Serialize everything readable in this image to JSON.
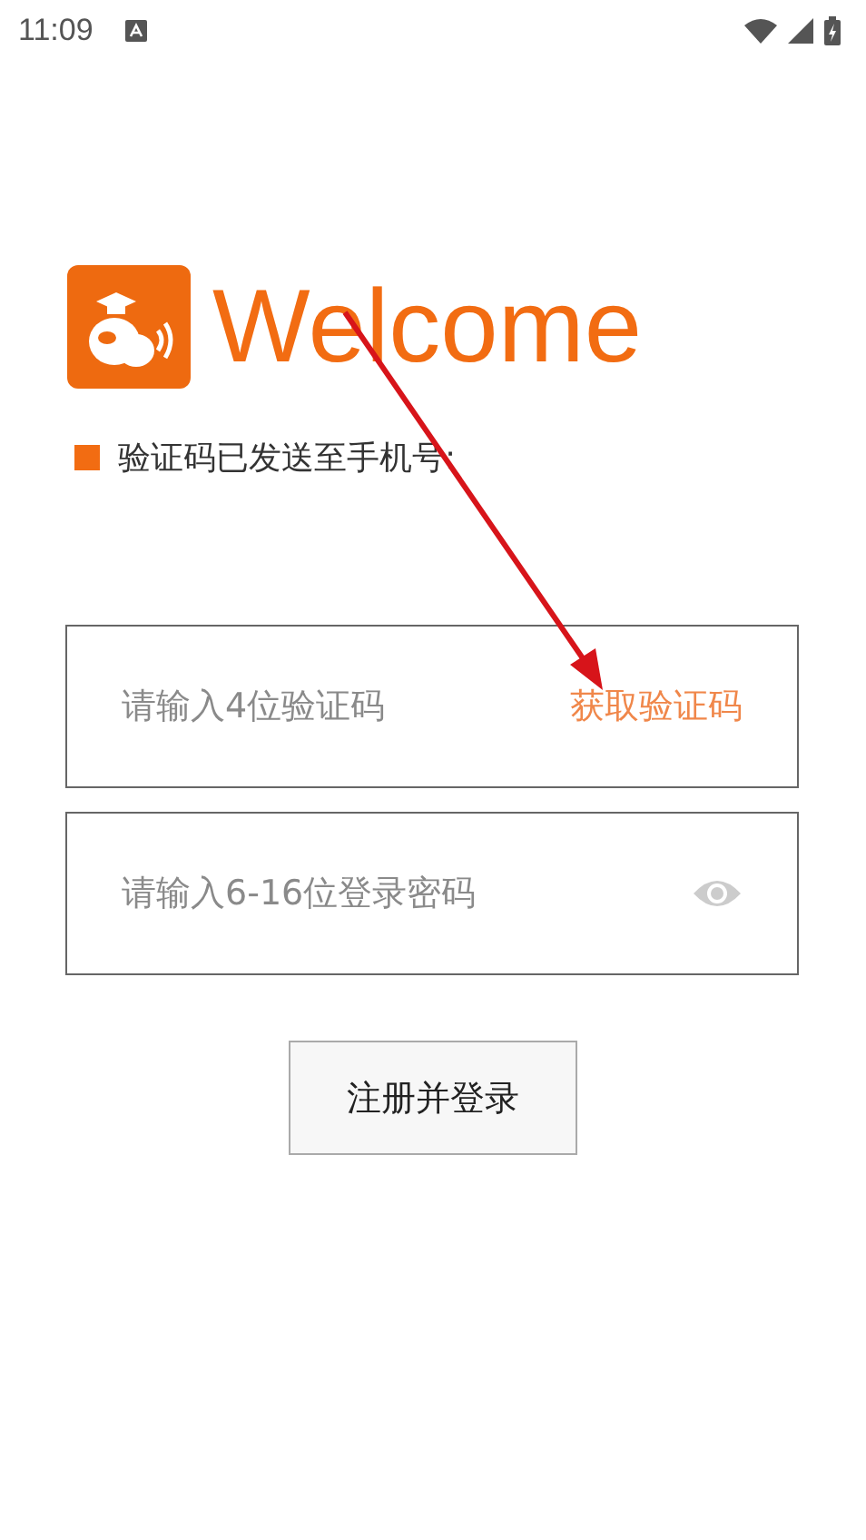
{
  "status_bar": {
    "time": "11:09"
  },
  "header": {
    "title": "Welcome"
  },
  "notice": {
    "text": "验证码已发送至手机号:"
  },
  "code_field": {
    "placeholder": "请输入4位验证码",
    "action": "获取验证码"
  },
  "password_field": {
    "placeholder": "请输入6-16位登录密码"
  },
  "submit_button": {
    "label": "注册并登录"
  }
}
